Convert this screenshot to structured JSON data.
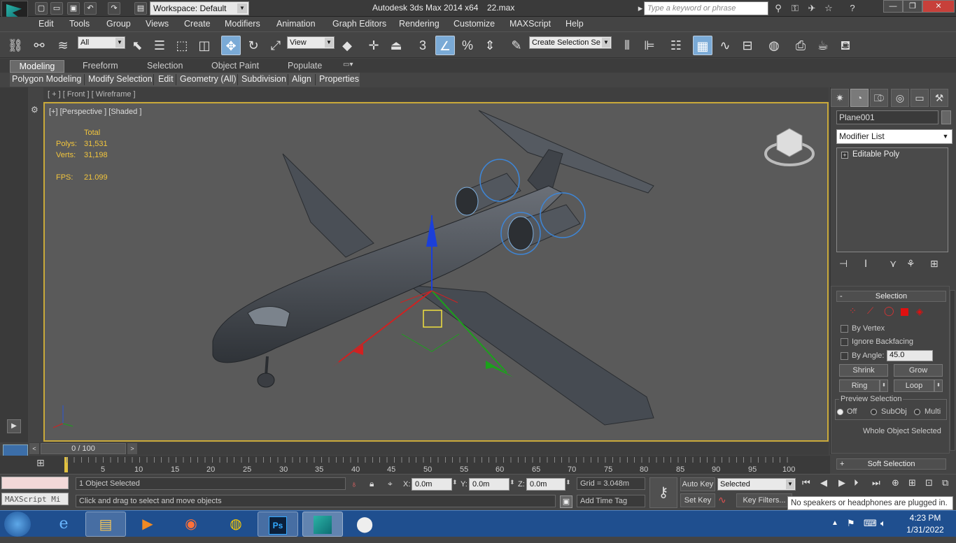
{
  "title_bar": {
    "workspace": "Workspace: Default",
    "app_title": "Autodesk 3ds Max  2014 x64",
    "file_name": "22.max",
    "search_placeholder": "Type a keyword or phrase"
  },
  "menu": [
    "Edit",
    "Tools",
    "Group",
    "Views",
    "Create",
    "Modifiers",
    "Animation",
    "Graph Editors",
    "Rendering",
    "Customize",
    "MAXScript",
    "Help"
  ],
  "toolbar": {
    "selection_filter": "All",
    "ref_coord": "View",
    "named_selection": "Create Selection Se",
    "snap_label": "3",
    "percent_label": "%"
  },
  "ribbon": {
    "tabs": [
      "Modeling",
      "Freeform",
      "Selection",
      "Object Paint",
      "Populate"
    ],
    "subtabs": [
      "Polygon Modeling",
      "Modify Selection",
      "Edit",
      "Geometry (All)",
      "Subdivision",
      "Align",
      "Properties"
    ]
  },
  "viewport": {
    "top_label": "[ + ] [ Front ] [ Wireframe ]",
    "label": "[+] [Perspective ] [Shaded ]",
    "stats": {
      "header": "Total",
      "polys_label": "Polys:",
      "polys": "31,531",
      "verts_label": "Verts:",
      "verts": "31,198",
      "fps_label": "FPS:",
      "fps": "21.099"
    }
  },
  "command_panel": {
    "object_name": "Plane001",
    "modifier_list": "Modifier List",
    "stack_item": "Editable Poly",
    "selection_title": "Selection",
    "by_vertex": "By Vertex",
    "ignore_backfacing": "Ignore Backfacing",
    "by_angle": "By Angle:",
    "angle_value": "45.0",
    "shrink": "Shrink",
    "grow": "Grow",
    "ring": "Ring",
    "loop": "Loop",
    "preview_title": "Preview Selection",
    "off": "Off",
    "subobj": "SubObj",
    "multi": "Multi",
    "whole_object": "Whole Object Selected",
    "soft_selection": "Soft Selection"
  },
  "timeline": {
    "slider_value": "0 / 100",
    "ticks": [
      "5",
      "10",
      "15",
      "20",
      "25",
      "30",
      "35",
      "40",
      "45",
      "50",
      "55",
      "60",
      "65",
      "70",
      "75",
      "80",
      "85",
      "90",
      "95",
      "100"
    ]
  },
  "status": {
    "maxscript": "MAXScript Mi",
    "selected": "1 Object Selected",
    "prompt": "Click and drag to select and move objects",
    "x_label": "X:",
    "x": "0.0m",
    "y_label": "Y:",
    "y": "0.0m",
    "z_label": "Z:",
    "z": "0.0m",
    "grid": "Grid = 3.048m",
    "add_time_tag": "Add Time Tag",
    "auto_key": "Auto Key",
    "set_key": "Set Key",
    "key_mode": "Selected",
    "key_filters": "Key Filters..."
  },
  "taskbar": {
    "time": "4:23 PM",
    "date": "1/31/2022",
    "tooltip": "No speakers or headphones are plugged in."
  }
}
